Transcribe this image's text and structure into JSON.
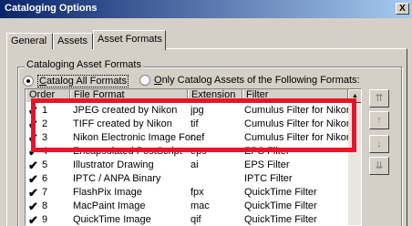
{
  "window": {
    "title": "Cataloging Options",
    "close_label": "X"
  },
  "tabs": [
    {
      "label": "General"
    },
    {
      "label": "Assets"
    },
    {
      "label": "Asset Formats"
    }
  ],
  "group": {
    "label": "Cataloging Asset Formats",
    "radio_all_label": "Catalog All Formats",
    "radio_only_label": "Only Catalog Assets of the Following Formats:"
  },
  "list": {
    "columns": [
      "Order",
      "File Format",
      "Extension",
      "Filter"
    ],
    "rows": [
      {
        "check": "✔",
        "order": "1",
        "format": "JPEG created by Nikon",
        "ext": "jpg",
        "filter": "Cumulus Filter for Nikon..."
      },
      {
        "check": "✔",
        "order": "2",
        "format": "TIFF created by Nikon",
        "ext": "tif",
        "filter": "Cumulus Filter for Nikon..."
      },
      {
        "check": "✔",
        "order": "3",
        "format": "Nikon Electronic Image For...",
        "ext": "nef",
        "filter": "Cumulus Filter for Nikon..."
      },
      {
        "check": "✔",
        "order": "4",
        "format": "Encapsulated PostScript",
        "ext": "eps",
        "filter": "EPS Filter"
      },
      {
        "check": "✔",
        "order": "5",
        "format": "Illustrator Drawing",
        "ext": "ai",
        "filter": "EPS Filter"
      },
      {
        "check": "✔",
        "order": "6",
        "format": "IPTC / ANPA Binary",
        "ext": "",
        "filter": "IPTC Filter"
      },
      {
        "check": "✔",
        "order": "7",
        "format": "FlashPix Image",
        "ext": "fpx",
        "filter": "QuickTime Filter"
      },
      {
        "check": "✔",
        "order": "8",
        "format": "MacPaint Image",
        "ext": "mac",
        "filter": "QuickTime Filter"
      },
      {
        "check": "✔",
        "order": "9",
        "format": "QuickTime Image",
        "ext": "qif",
        "filter": "QuickTime Filter"
      }
    ]
  },
  "side_buttons": [
    {
      "icon": "move-top-icon",
      "glyph": "⇈"
    },
    {
      "icon": "move-up-icon",
      "glyph": "↑"
    },
    {
      "icon": "move-down-icon",
      "glyph": "↓"
    },
    {
      "icon": "move-bottom-icon",
      "glyph": "⇊"
    }
  ],
  "scroll_up_glyph": "▲",
  "colors": {
    "highlight": "#e8142a",
    "titlebar_start": "#0a246a",
    "titlebar_end": "#a6caf0"
  }
}
